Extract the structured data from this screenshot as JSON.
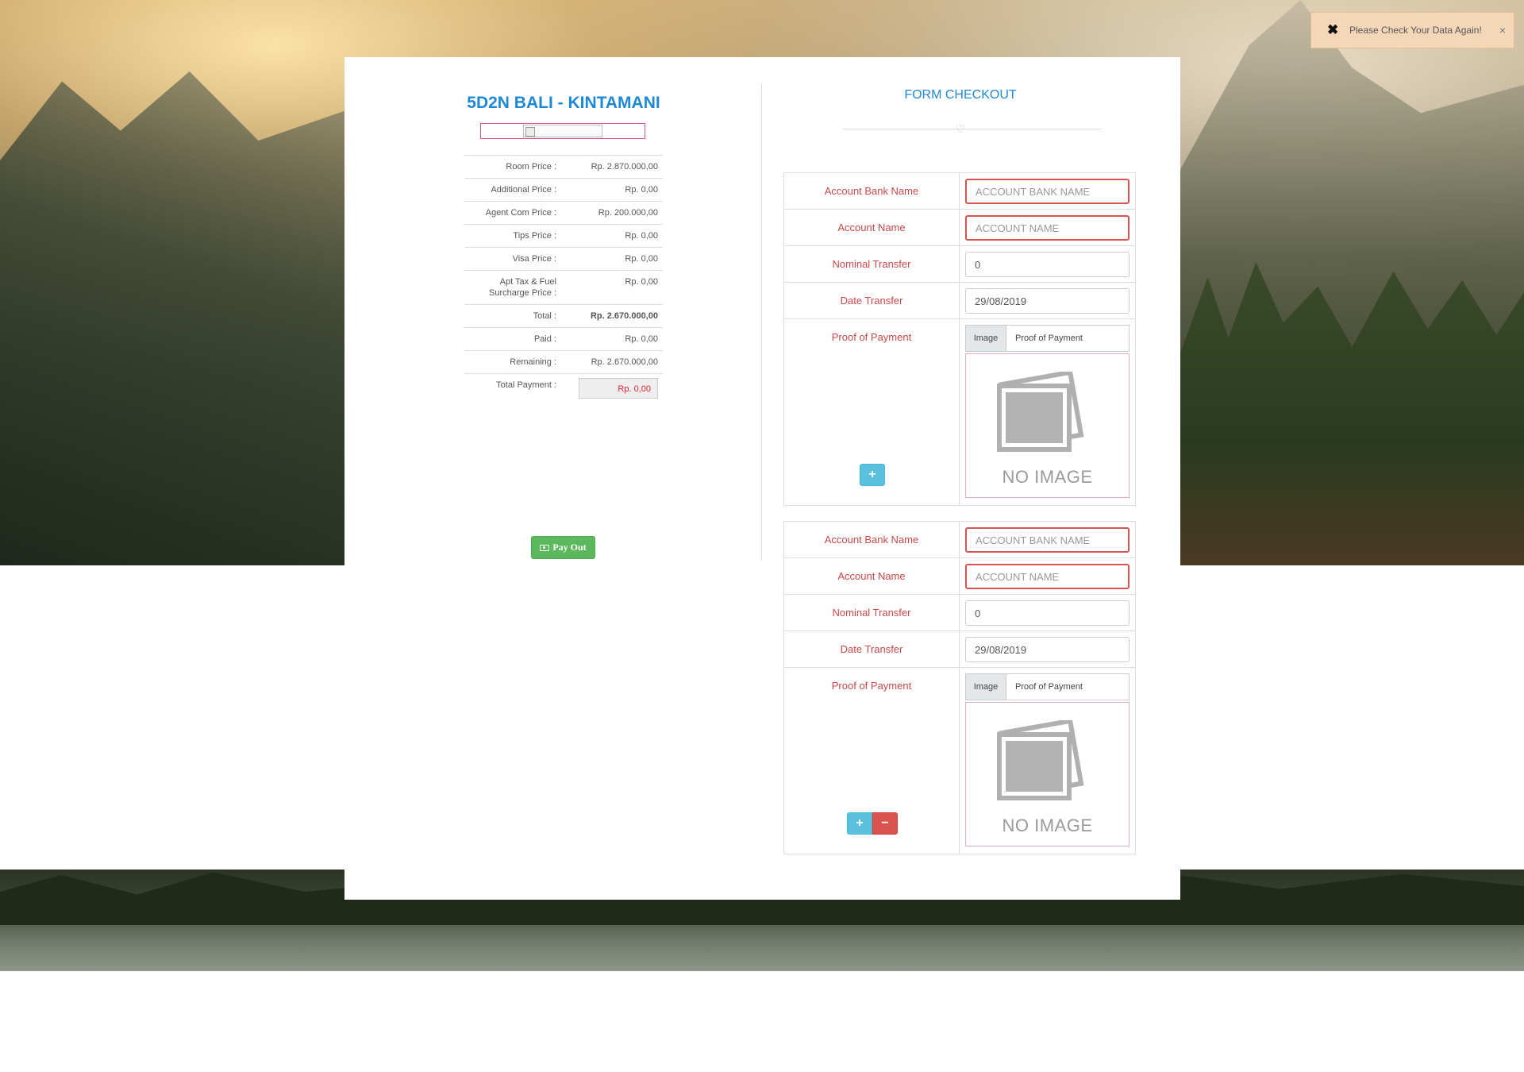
{
  "toast": {
    "message": "Please Check Your Data Again!",
    "icon": "x-icon",
    "close_icon": "close-icon"
  },
  "package": {
    "title": "5D2N BALI - KINTAMANI"
  },
  "prices": [
    {
      "label": "Room Price :",
      "value": "Rp. 2.870.000,00"
    },
    {
      "label": "Additional Price :",
      "value": "Rp. 0,00"
    },
    {
      "label": "Agent Com Price :",
      "value": "Rp. 200.000,00"
    },
    {
      "label": "Tips Price :",
      "value": "Rp. 0,00"
    },
    {
      "label": "Visa Price :",
      "value": "Rp. 0,00"
    },
    {
      "label_line1": "Apt Tax & Fuel",
      "label_line2": "Surcharge Price :",
      "value": "Rp. 0,00"
    },
    {
      "label": "Total :",
      "value": "Rp. 2.670.000,00"
    },
    {
      "label": "Paid :",
      "value": "Rp. 0,00"
    },
    {
      "label": "Remaining :",
      "value": "Rp. 2.670.000,00"
    }
  ],
  "total_payment": {
    "label": "Total Payment :",
    "value": "Rp. 0,00"
  },
  "payout_button": {
    "label": "Pay Out",
    "icon": "money-icon"
  },
  "form": {
    "title": "FORM CHECKOUT",
    "ornament_icon": "heart-icon",
    "labels": {
      "bank": "Account Bank Name",
      "account": "Account Name",
      "nominal": "Nominal Transfer",
      "date": "Date Transfer",
      "proof": "Proof of Payment"
    },
    "placeholders": {
      "bank": "ACCOUNT BANK NAME",
      "account": "ACCOUNT NAME"
    },
    "file_addon": "Image",
    "file_label": "Proof of Payment",
    "no_image": "NO IMAGE",
    "entries": [
      {
        "nominal": "0",
        "date": "29/08/2019"
      },
      {
        "nominal": "0",
        "date": "29/08/2019"
      }
    ],
    "add_button": "+",
    "remove_button": "−"
  },
  "colors": {
    "accent_blue": "#1e88d4",
    "error_red": "#d9534f",
    "label_red": "#c9484a",
    "success_green": "#5cb85c",
    "info_blue": "#5bc0de",
    "toast_bg": "#f4d6b9"
  }
}
